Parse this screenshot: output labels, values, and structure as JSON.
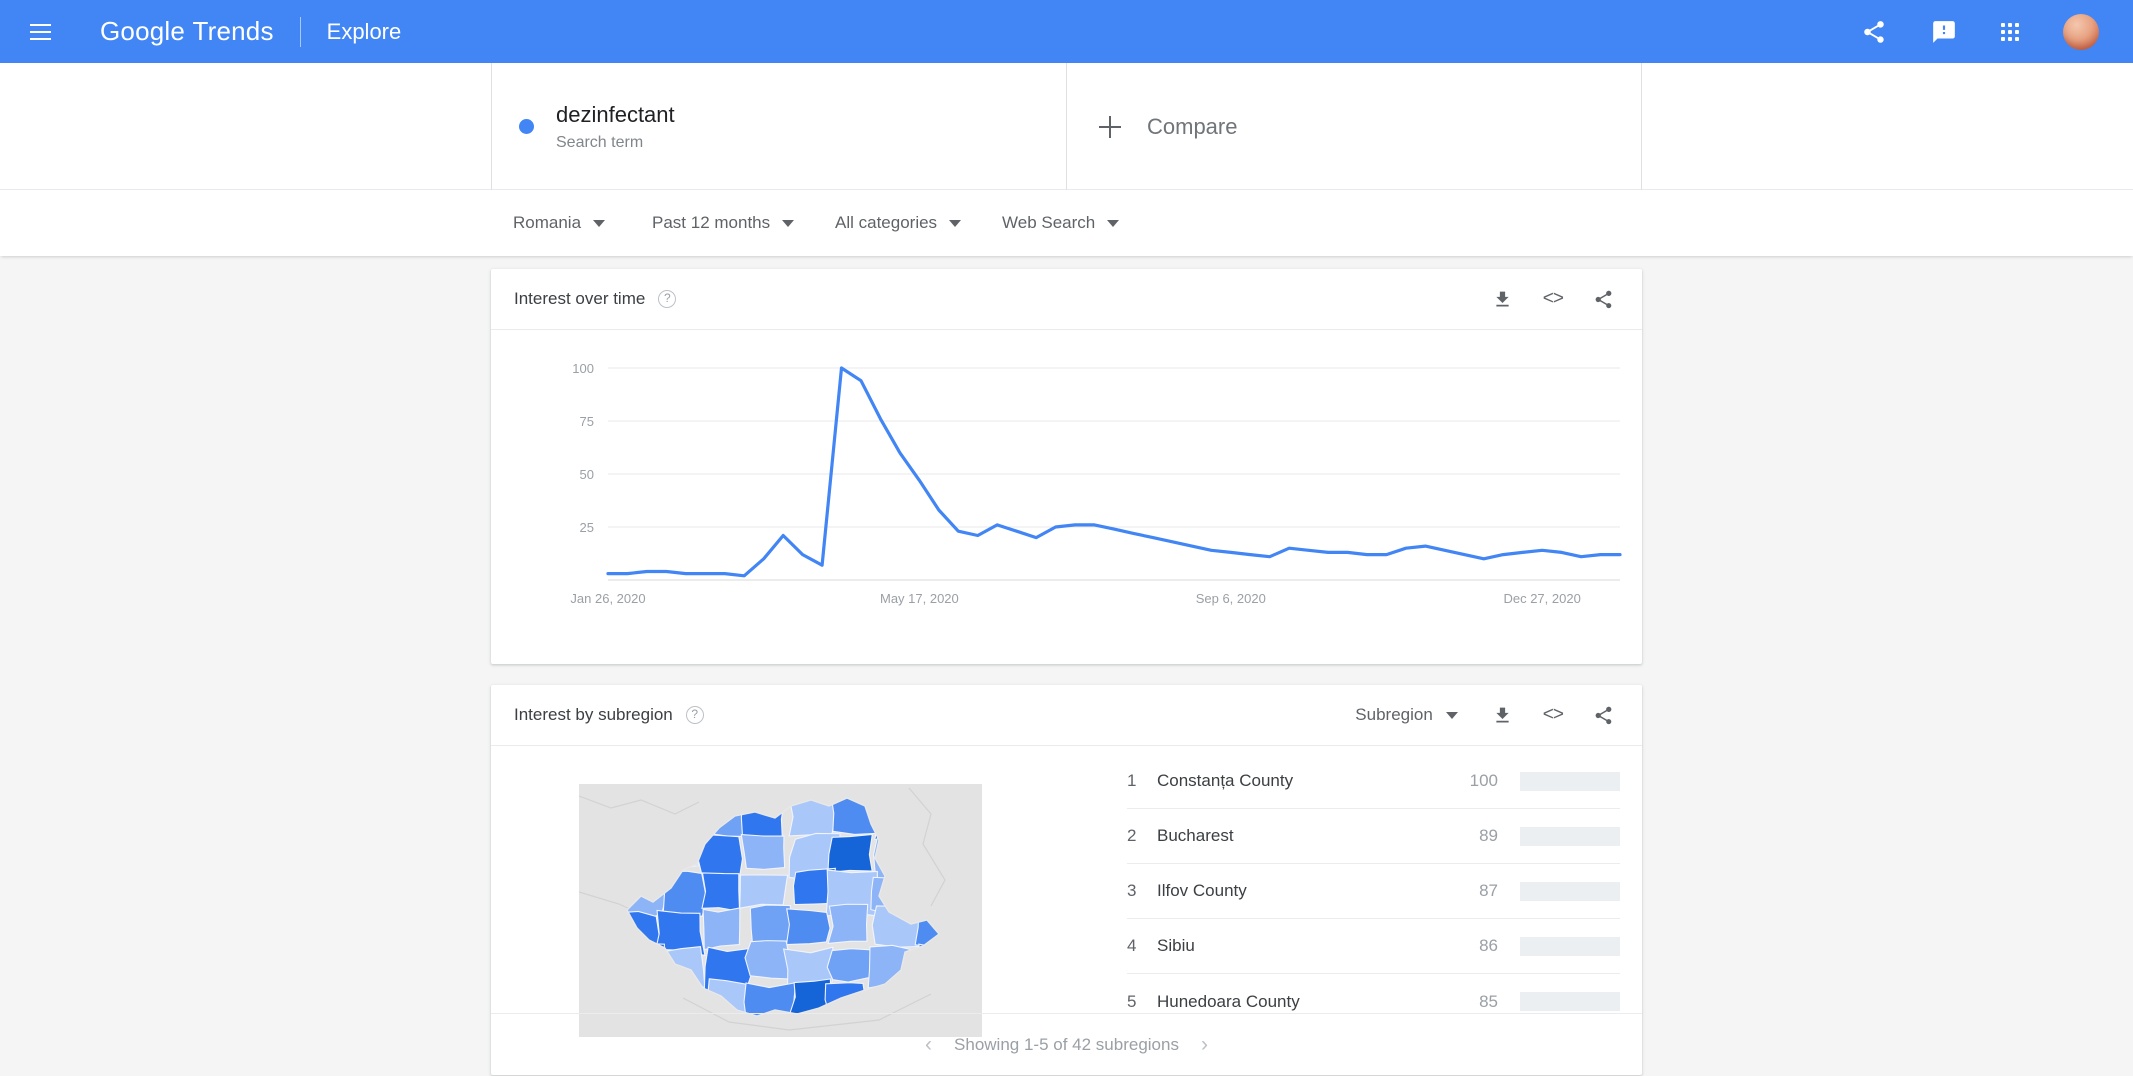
{
  "appbar": {
    "menu_icon": "hamburger-menu-icon",
    "brand_google": "Google",
    "brand_trends": "Trends",
    "explore": "Explore",
    "share_icon": "share-icon",
    "feedback_icon": "feedback-icon",
    "apps_icon": "apps-grid-icon",
    "avatar_icon": "user-avatar"
  },
  "query": {
    "term": "dezinfectant",
    "term_type": "Search term",
    "term_color": "#4285f4",
    "compare_label": "Compare"
  },
  "filters": [
    {
      "label": "Romania"
    },
    {
      "label": "Past 12 months"
    },
    {
      "label": "All categories"
    },
    {
      "label": "Web Search"
    }
  ],
  "interest_over_time": {
    "title": "Interest over time",
    "help": "?",
    "download_icon": "download-icon",
    "embed_icon": "embed-code-icon",
    "share_icon": "share-icon"
  },
  "interest_by_subregion": {
    "title": "Interest by subregion",
    "help": "?",
    "scope_label": "Subregion",
    "download_icon": "download-icon",
    "embed_icon": "embed-code-icon",
    "share_icon": "share-icon",
    "rows": [
      {
        "rank": "1",
        "name": "Constanța County",
        "value": "100",
        "pct": 100
      },
      {
        "rank": "2",
        "name": "Bucharest",
        "value": "89",
        "pct": 89
      },
      {
        "rank": "3",
        "name": "Ilfov County",
        "value": "87",
        "pct": 87
      },
      {
        "rank": "4",
        "name": "Sibiu",
        "value": "86",
        "pct": 86
      },
      {
        "rank": "5",
        "name": "Hunedoara County",
        "value": "85",
        "pct": 85
      }
    ],
    "pager_prev": "‹",
    "pager_text": "Showing 1-5 of 42 subregions",
    "pager_next": "›"
  },
  "chart_data": {
    "type": "line",
    "title": "Interest over time",
    "xlabel": "",
    "ylabel": "",
    "ylim": [
      0,
      100
    ],
    "yticks": [
      25,
      50,
      75,
      100
    ],
    "grid": true,
    "legend": false,
    "line_color": "#4285f4",
    "xticks": [
      "Jan 26, 2020",
      "May 17, 2020",
      "Sep 6, 2020",
      "Dec 27, 2020"
    ],
    "xtick_index": [
      0,
      16,
      32,
      48
    ],
    "series": [
      {
        "name": "dezinfectant",
        "values": [
          3,
          3,
          4,
          4,
          3,
          3,
          3,
          2,
          10,
          21,
          12,
          7,
          100,
          94,
          76,
          60,
          47,
          33,
          23,
          21,
          26,
          23,
          20,
          25,
          26,
          26,
          24,
          22,
          20,
          18,
          16,
          14,
          13,
          12,
          11,
          15,
          14,
          13,
          13,
          12,
          12,
          15,
          16,
          14,
          12,
          10,
          12,
          13,
          14,
          13,
          11,
          12,
          12
        ]
      }
    ]
  },
  "map": {
    "name": "romania-choropleth-map",
    "ocean_color": "#e3e3e3",
    "shades": [
      "#a9c7f8",
      "#8cb4f6",
      "#6fa1f4",
      "#4f8cf2",
      "#2f76ef",
      "#1565d8"
    ]
  }
}
